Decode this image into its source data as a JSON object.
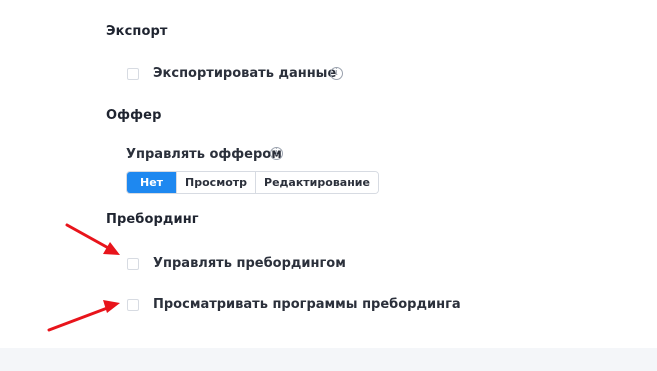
{
  "export": {
    "title": "Экспорт",
    "items": [
      {
        "label": "Экспортировать данные",
        "checked": false,
        "info_icon": "info-icon"
      }
    ]
  },
  "offer": {
    "title": "Оффер",
    "manage_label": "Управлять оффером",
    "info_icon": "info-icon",
    "options": [
      "Нет",
      "Просмотр",
      "Редактирование"
    ],
    "selected": "Нет",
    "accent_color": "#1e88f0"
  },
  "preboarding": {
    "title": "Пребординг",
    "items": [
      {
        "label": "Управлять пребордингом",
        "checked": false
      },
      {
        "label": "Просматривать программы пребординга",
        "checked": false
      }
    ]
  },
  "annotations": {
    "arrow_color": "#e8141b"
  }
}
